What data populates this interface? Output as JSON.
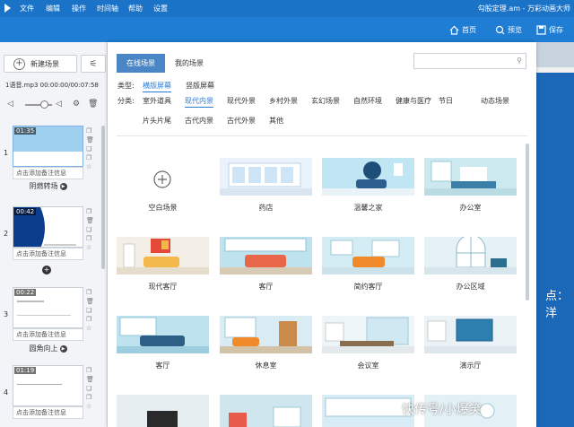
{
  "app": {
    "doc_title": "勾股定理.am - 万彩动画大师",
    "menus": [
      "文件",
      "编辑",
      "操作",
      "时间轴",
      "帮助",
      "设置"
    ]
  },
  "toolbar": {
    "home": "首页",
    "preview": "预览",
    "save": "保存"
  },
  "sidebar": {
    "add_scene": "新建场景",
    "audio": {
      "file": "1语音.mp3",
      "time": "00:00:00/00:07:58"
    },
    "note_placeholder": "点击添加备注信息",
    "scenes": [
      {
        "num": "1",
        "time": "01:35",
        "transition": "阴燃转场"
      },
      {
        "num": "2",
        "time": "00:42",
        "transition": ""
      },
      {
        "num": "3",
        "time": "00:22",
        "transition": "圆角向上"
      },
      {
        "num": "4",
        "time": "01:19",
        "transition": ""
      }
    ]
  },
  "panel": {
    "tabs": [
      "在线场景",
      "我的场景"
    ],
    "active_tab": "在线场景",
    "search": {
      "placeholder": ""
    },
    "type_label": "类型:",
    "types": [
      "横版屏幕",
      "竖版屏幕"
    ],
    "category_label": "分类:",
    "categories_row1": [
      "室外道具",
      "现代内景",
      "现代外景",
      "乡村外景",
      "玄幻场景",
      "自然环境",
      "健康与医疗",
      "节日",
      "动态场景"
    ],
    "categories_row2": [
      "片头片尾",
      "古代内景",
      "古代外景",
      "其他"
    ],
    "selected_type": "横版屏幕",
    "selected_category": "现代内景",
    "cards": [
      {
        "label": "空白场景",
        "icon": "plus-icon"
      },
      {
        "label": "药店"
      },
      {
        "label": "温馨之家"
      },
      {
        "label": "办公室"
      },
      {
        "label": "现代客厅"
      },
      {
        "label": "客厅"
      },
      {
        "label": "简约客厅"
      },
      {
        "label": "办公区域"
      },
      {
        "label": "客厅"
      },
      {
        "label": "休息室"
      },
      {
        "label": "会议室"
      },
      {
        "label": "演示厅"
      },
      {
        "label": ""
      },
      {
        "label": ""
      },
      {
        "label": ""
      },
      {
        "label": ""
      }
    ]
  },
  "stage": {
    "text": "点：洋"
  },
  "watermark": "快传号/小爆笑",
  "colors": {
    "titlebar": "#1a73c7",
    "toolbar": "#1f7dd3",
    "accent": "#2a7bd6",
    "tab_active": "#4a86c5"
  }
}
